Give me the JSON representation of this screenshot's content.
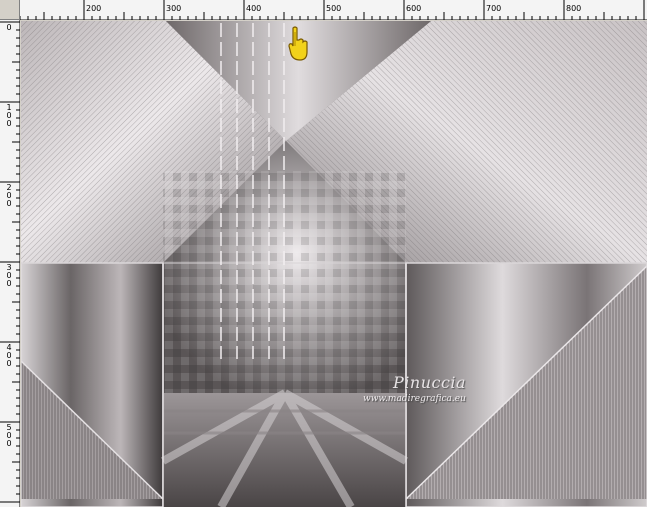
{
  "rulers": {
    "horizontal_labels": [
      "200",
      "300",
      "400",
      "500",
      "600",
      "700",
      "800"
    ],
    "vertical_labels": [
      "0",
      "100",
      "200",
      "300",
      "400",
      "500"
    ]
  },
  "canvas": {
    "watermark_title": "Pinuccia",
    "watermark_url": "www.madiregrafica.eu",
    "palette": {
      "light": "#ece8ea",
      "mid": "#a8a2a4",
      "dark": "#3a3637"
    }
  },
  "cursor": {
    "icon": "hand-pointer-icon",
    "color": "#f2d21a"
  }
}
